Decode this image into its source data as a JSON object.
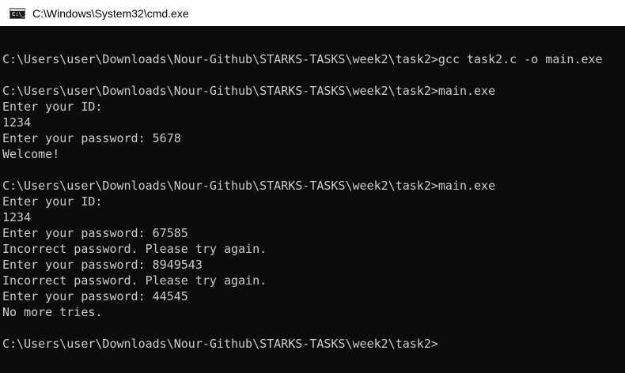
{
  "window": {
    "title": "C:\\Windows\\System32\\cmd.exe",
    "icon": "cmd-icon",
    "icon_text": "C:\\_"
  },
  "console": {
    "lines": [
      "",
      "C:\\Users\\user\\Downloads\\Nour-Github\\STARKS-TASKS\\week2\\task2>gcc task2.c -o main.exe",
      "",
      "C:\\Users\\user\\Downloads\\Nour-Github\\STARKS-TASKS\\week2\\task2>main.exe",
      "Enter your ID:",
      "1234",
      "Enter your password: 5678",
      "Welcome!",
      "",
      "C:\\Users\\user\\Downloads\\Nour-Github\\STARKS-TASKS\\week2\\task2>main.exe",
      "Enter your ID:",
      "1234",
      "Enter your password: 67585",
      "Incorrect password. Please try again.",
      "Enter your password: 8949543",
      "Incorrect password. Please try again.",
      "Enter your password: 44545",
      "No more tries.",
      "",
      "C:\\Users\\user\\Downloads\\Nour-Github\\STARKS-TASKS\\week2\\task2>"
    ]
  },
  "colors": {
    "console_background": "#0c0c0c",
    "console_text": "#cccccc",
    "titlebar_background": "#ffffff"
  }
}
